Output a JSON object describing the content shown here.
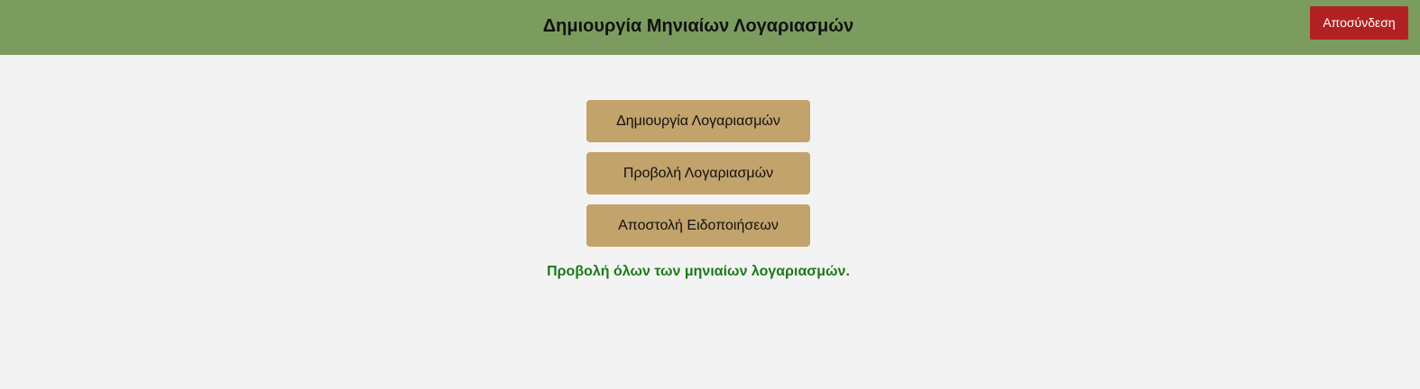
{
  "header": {
    "title": "Δημιουργία Μηνιαίων Λογαριασμών",
    "logout_label": "Αποσύνδεση"
  },
  "menu": {
    "items": [
      {
        "label": "Δημιουργία Λογαριασμών"
      },
      {
        "label": "Προβολή Λογαριασμών"
      },
      {
        "label": "Αποστολή Ειδοποιήσεων"
      }
    ]
  },
  "status": {
    "message": "Προβολή όλων των μηνιαίων λογαριασμών."
  },
  "colors": {
    "header_bg": "#7b9c5e",
    "logout_bg": "#b02222",
    "button_bg": "#c2a36c",
    "message_text": "#1a7a1a",
    "page_bg": "#f3f3f3"
  }
}
